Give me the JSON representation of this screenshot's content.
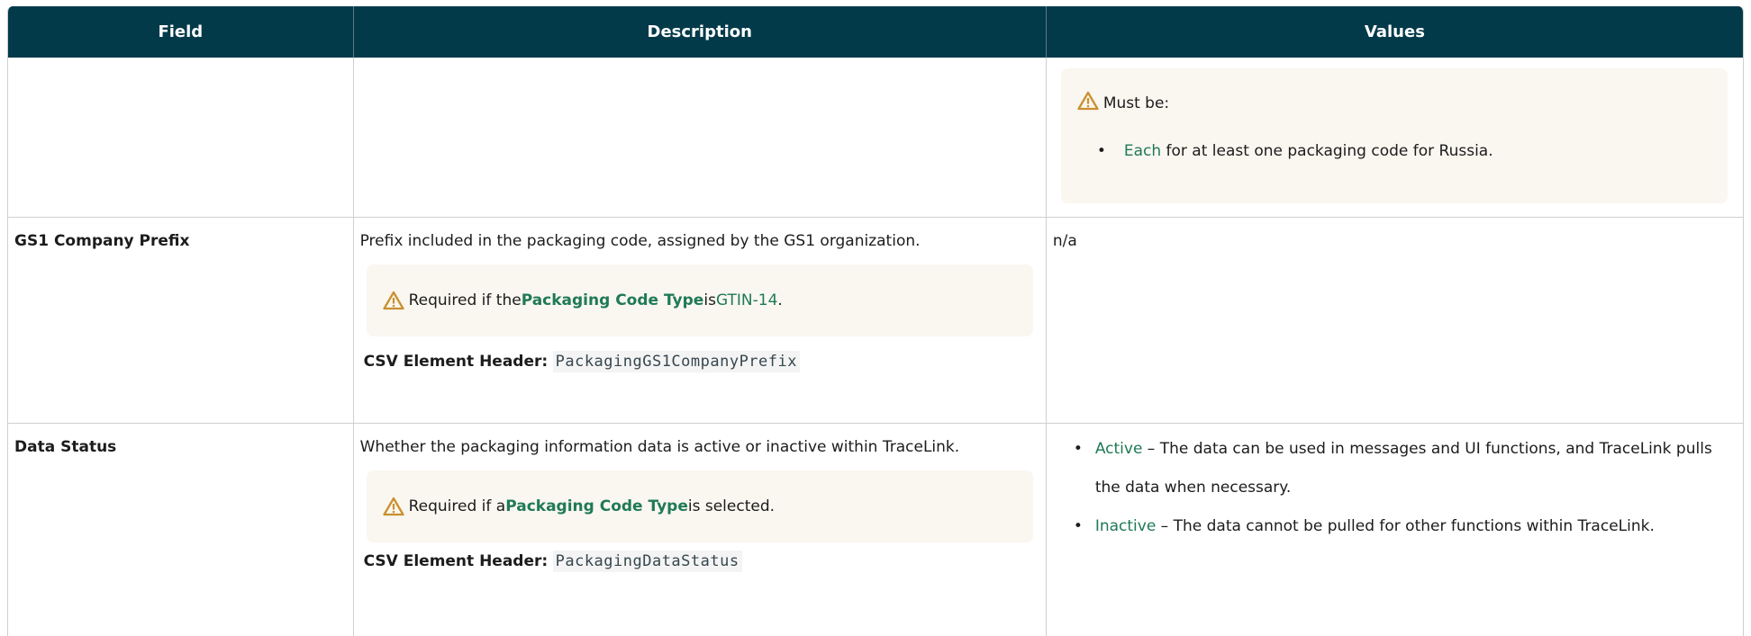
{
  "header": {
    "field": "Field",
    "description": "Description",
    "values": "Values"
  },
  "row1": {
    "values_note": {
      "intro": "Must be:",
      "item_keyword": "Each",
      "item_text": " for at least one packaging code for Russia."
    }
  },
  "row2": {
    "field": "GS1 Company Prefix",
    "description": "Prefix included in the packaging code, assigned by the GS1 organization.",
    "note": {
      "prefix": "Required if the ",
      "field_ref": "Packaging Code Type",
      "middle": " is ",
      "value_ref": "GTIN-14",
      "suffix": "."
    },
    "csv_label": "CSV Element Header:",
    "csv_code": "PackagingGS1CompanyPrefix",
    "values": "n/a"
  },
  "row3": {
    "field": "Data Status",
    "description": "Whether the packaging information data is active or inactive within TraceLink.",
    "note": {
      "prefix": "Required if a ",
      "field_ref": "Packaging Code Type",
      "suffix": " is selected."
    },
    "csv_label": "CSV Element Header:",
    "csv_code": "PackagingDataStatus",
    "values": [
      {
        "keyword": "Active",
        "text": " – The data can be used in messages and UI functions, and TraceLink pulls the data when necessary."
      },
      {
        "keyword": "Inactive",
        "text": " – The data cannot be pulled for other functions within TraceLink."
      }
    ]
  },
  "colors": {
    "header_bg": "#033a4a",
    "link_green": "#1f7a55",
    "note_bg": "#faf6f0",
    "warning_icon": "#c9902f"
  },
  "icons": [
    "warning-triangle-icon"
  ]
}
